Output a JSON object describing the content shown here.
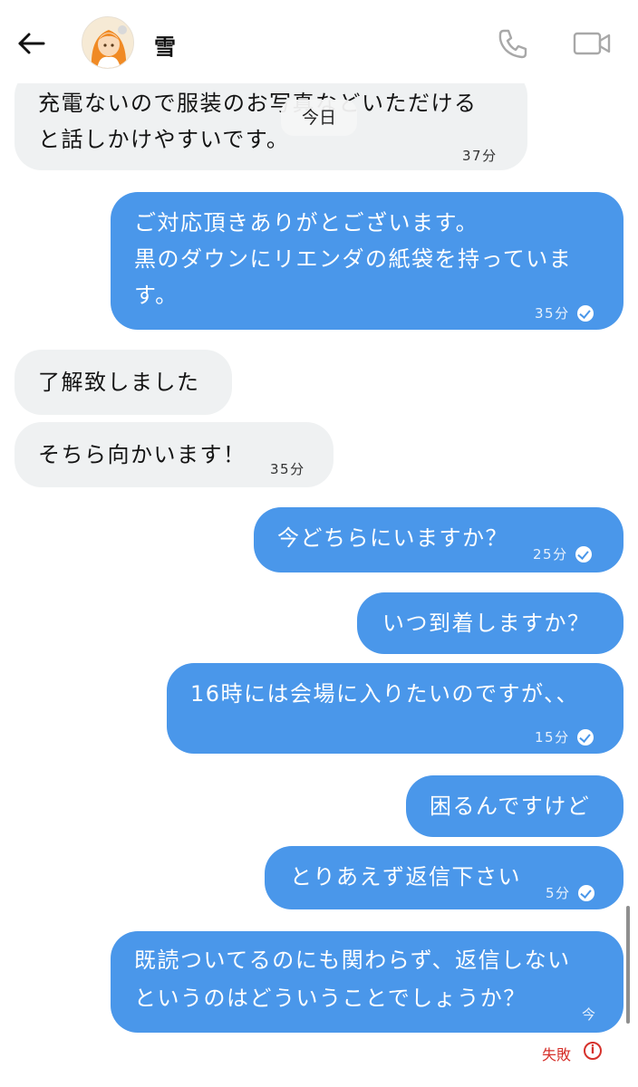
{
  "header": {
    "contact_name": "雪",
    "icons": {
      "back": "back-arrow-icon",
      "call": "phone-icon",
      "video": "video-camera-icon"
    }
  },
  "date_divider": "今日",
  "messages": [
    {
      "direction": "received",
      "lines": [
        "充電ないので服装のお写真などいただける",
        "と話しかけやすいです。"
      ],
      "time": "37分"
    },
    {
      "direction": "sent",
      "lines": [
        "ご対応頂きありがとございます。",
        "黒のダウンにリエンダの紙袋を持っていま",
        "す。"
      ],
      "time": "35分",
      "read": true
    },
    {
      "direction": "received",
      "lines": [
        "了解致しました"
      ]
    },
    {
      "direction": "received",
      "lines": [
        "そちら向かいます！"
      ],
      "time": "35分"
    },
    {
      "direction": "sent",
      "lines": [
        "今どちらにいますか？"
      ],
      "time": "25分",
      "read": true
    },
    {
      "direction": "sent",
      "lines": [
        "いつ到着しますか？"
      ]
    },
    {
      "direction": "sent",
      "lines": [
        "16時には会場に入りたいのですが、、"
      ],
      "time": "15分",
      "read": true
    },
    {
      "direction": "sent",
      "lines": [
        "困るんですけど"
      ]
    },
    {
      "direction": "sent",
      "lines": [
        "とりあえず返信下さい"
      ],
      "time": "5分",
      "read": true
    },
    {
      "direction": "sent",
      "lines": [
        "既読ついてるのにも関わらず、返信しない",
        "というのはどういうことでしょうか？"
      ],
      "time": "今",
      "status": "失敗"
    }
  ],
  "colors": {
    "sent_bubble": "#4a97ea",
    "received_bubble": "#eff1f2",
    "failed": "#d6312b"
  }
}
